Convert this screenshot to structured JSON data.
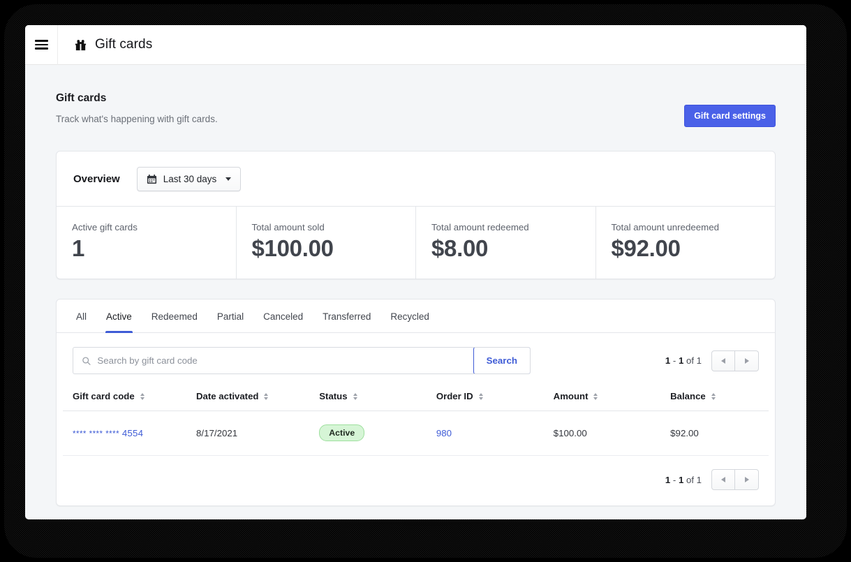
{
  "topbar": {
    "menu_icon": "hamburger-icon",
    "app_icon": "gift-icon",
    "title": "Gift cards"
  },
  "page": {
    "title": "Gift cards",
    "subtitle": "Track what's happening with gift cards.",
    "settings_button": "Gift card settings"
  },
  "overview": {
    "title": "Overview",
    "daterange": {
      "icon": "calendar-icon",
      "label": "Last 30 days",
      "caret": "chevron-down-icon"
    },
    "metrics": [
      {
        "label": "Active gift cards",
        "value": "1"
      },
      {
        "label": "Total amount sold",
        "value": "$100.00"
      },
      {
        "label": "Total amount redeemed",
        "value": "$8.00"
      },
      {
        "label": "Total amount unredeemed",
        "value": "$92.00"
      }
    ]
  },
  "tabs": [
    {
      "label": "All",
      "active": false
    },
    {
      "label": "Active",
      "active": true
    },
    {
      "label": "Redeemed",
      "active": false
    },
    {
      "label": "Partial",
      "active": false
    },
    {
      "label": "Canceled",
      "active": false
    },
    {
      "label": "Transferred",
      "active": false
    },
    {
      "label": "Recycled",
      "active": false
    }
  ],
  "search": {
    "placeholder": "Search by gift card code",
    "value": "",
    "button_label": "Search",
    "icon": "search-icon"
  },
  "pagination": {
    "range_start": "1",
    "range_end": "1",
    "separator": " - ",
    "of_label": " of ",
    "total": "1",
    "prev_icon": "triangle-left-icon",
    "next_icon": "triangle-right-icon"
  },
  "table": {
    "columns": [
      "Gift card code",
      "Date activated",
      "Status",
      "Order ID",
      "Amount",
      "Balance"
    ],
    "rows": [
      {
        "code_mask": "**** **** ****",
        "code_last4": "4554",
        "date_activated": "8/17/2021",
        "status": "Active",
        "order_id": "980",
        "amount": "$100.00",
        "balance": "$92.00"
      }
    ]
  },
  "colors": {
    "accent_blue": "#4a61e8",
    "link_blue": "#3f5cd6",
    "badge_green_bg": "#d6f5d6",
    "badge_green_border": "#9ddf9d",
    "page_bg": "#f4f6f8"
  }
}
